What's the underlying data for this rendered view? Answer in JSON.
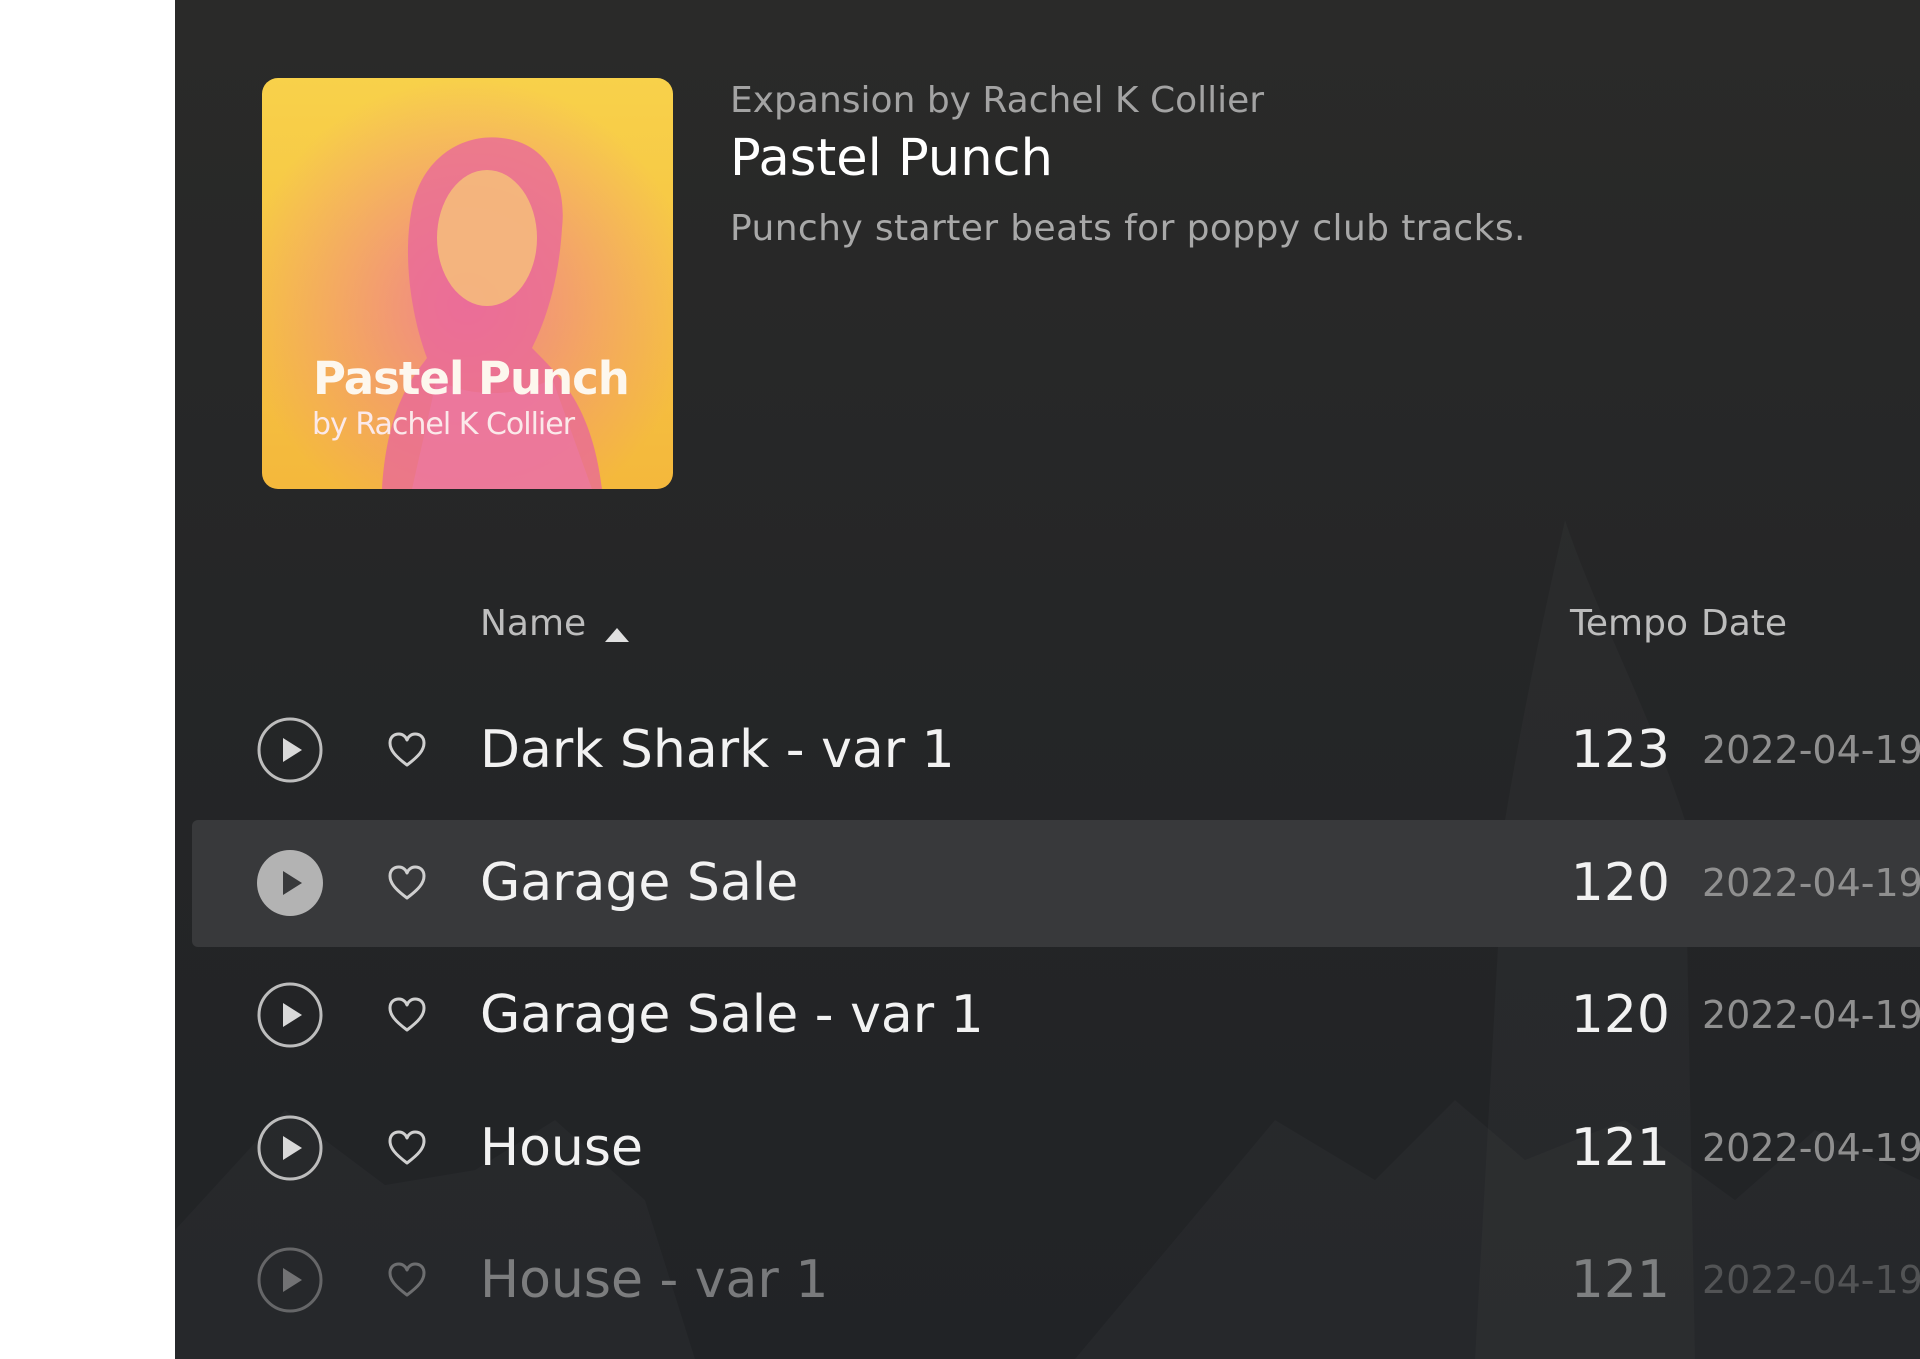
{
  "header": {
    "kicker": "Expansion by Rachel K Collier",
    "title": "Pastel Punch",
    "description": "Punchy starter beats for poppy club tracks."
  },
  "cover": {
    "title": "Pastel Punch",
    "subtitle": "by Rachel K Collier",
    "gradient_colors": [
      "#f5c93a",
      "#ef6fa4"
    ]
  },
  "table": {
    "columns": {
      "name": "Name",
      "tempo": "Tempo",
      "date": "Date"
    },
    "sort": {
      "column": "Name",
      "direction": "ascending",
      "icon": "sort-ascending-icon"
    },
    "rows": [
      {
        "name": "Dark Shark - var 1",
        "tempo": "123",
        "date": "2022-04-19"
      },
      {
        "name": "Garage Sale",
        "tempo": "120",
        "date": "2022-04-19",
        "selected": true
      },
      {
        "name": "Garage Sale - var 1",
        "tempo": "120",
        "date": "2022-04-19"
      },
      {
        "name": "House",
        "tempo": "121",
        "date": "2022-04-19"
      },
      {
        "name": "House - var 1",
        "tempo": "121",
        "date": "2022-04-19"
      }
    ]
  },
  "colors": {
    "panel_bg": "#262729",
    "selected_row_bg": "#38393b",
    "text_primary": "#f2f2f2",
    "text_secondary": "#a3a3a3"
  }
}
